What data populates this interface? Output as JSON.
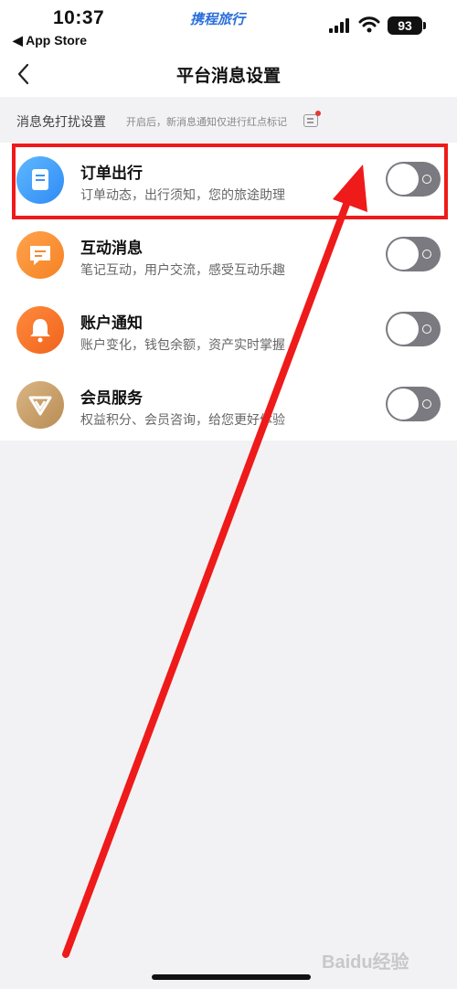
{
  "status_bar": {
    "time": "10:37",
    "back_app": "◀ App Store",
    "brand": "携程旅行",
    "battery": "93",
    "icons": [
      "cellular-signal-icon",
      "wifi-icon",
      "battery-icon"
    ]
  },
  "nav": {
    "title": "平台消息设置",
    "back_icon": "chevron-left-icon"
  },
  "dnd": {
    "title": "消息免打扰设置",
    "note": "开启后，新消息通知仅进行红点标记"
  },
  "settings": [
    {
      "title": "订单出行",
      "desc": "订单动态，出行须知，您的旅途助理",
      "icon": "order-document-icon",
      "enabled": false
    },
    {
      "title": "互动消息",
      "desc": "笔记互动，用户交流，感受互动乐趣",
      "icon": "chat-bubble-icon",
      "enabled": false
    },
    {
      "title": "账户通知",
      "desc": "账户变化，钱包余额，资产实时掌握",
      "icon": "bell-icon",
      "enabled": false
    },
    {
      "title": "会员服务",
      "desc": "权益积分、会员咨询，给您更好体验",
      "icon": "member-diamond-icon",
      "enabled": false
    }
  ],
  "watermark": "Baidu经验",
  "colors": {
    "annotation": "#ef1a1a",
    "toggle_off": "#7a7a80",
    "brand": "#2a6fdb"
  }
}
